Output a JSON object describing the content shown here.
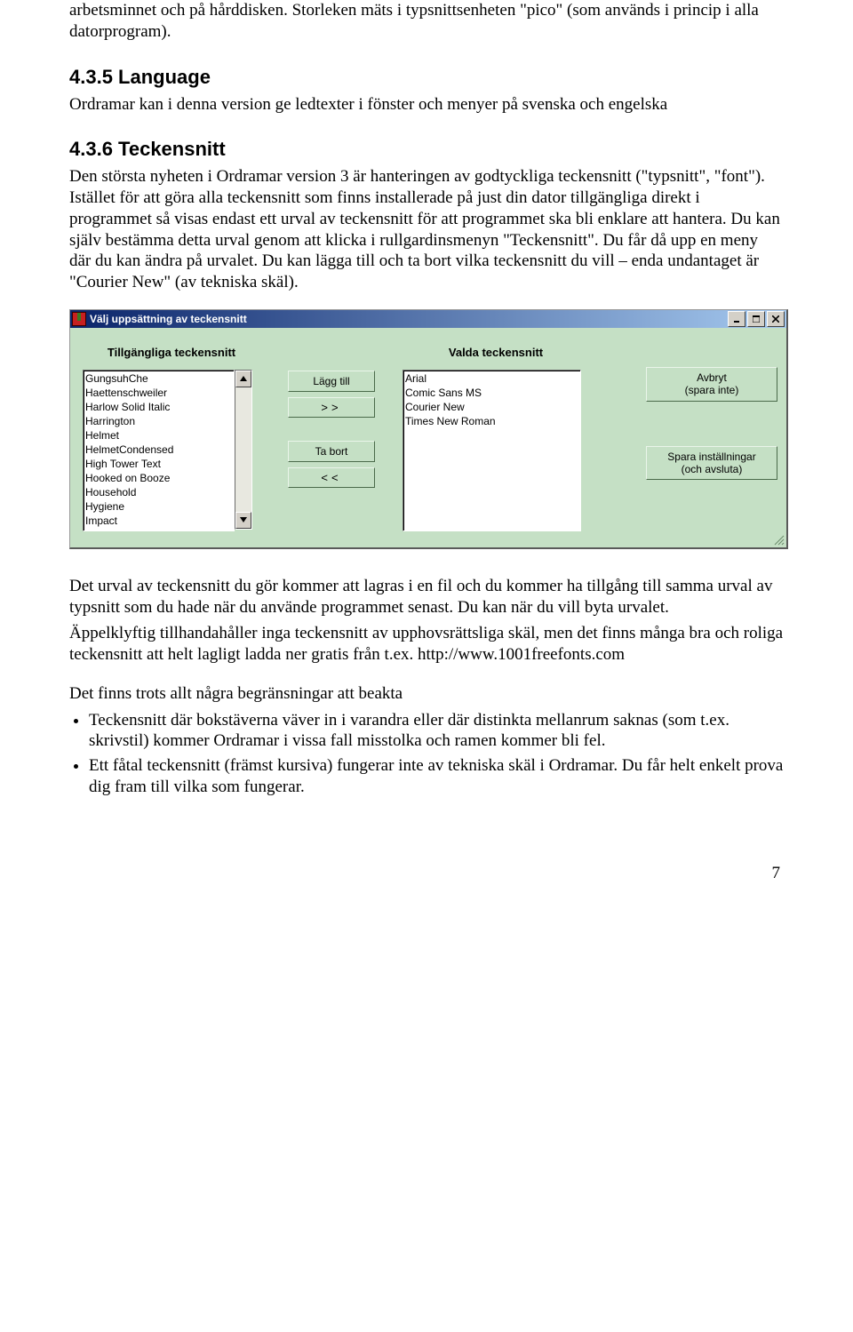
{
  "para_intro": "arbetsminnet och på hårddisken. Storleken mäts i typsnittsenheten \"pico\" (som används i princip i alla datorprogram).",
  "h_lang": "4.3.5 Language",
  "para_lang": "Ordramar kan i denna version ge ledtexter i fönster och menyer på svenska och engelska",
  "h_teck": "4.3.6 Teckensnitt",
  "para_teck": "Den största nyheten i Ordramar version 3 är hanteringen av godtyckliga teckensnitt (\"typsnitt\", \"font\"). Istället för att göra alla teckensnitt som finns installerade på just din dator tillgängliga direkt i programmet så visas endast ett urval av teckensnitt för att programmet ska bli enklare att hantera. Du kan själv bestämma detta urval genom att klicka i rullgardinsmenyn \"Teckensnitt\". Du får då upp en meny där du kan ändra på urvalet. Du kan lägga till och ta bort vilka teckensnitt du vill – enda undantaget är \"Courier New\" (av tekniska skäl).",
  "dialog": {
    "title": "Välj uppsättning av teckensnitt",
    "left_label": "Tillgängliga teckensnitt",
    "right_label": "Valda teckensnitt",
    "add_label": "Lägg till",
    "add_glyph": ">>",
    "remove_label": "Ta bort",
    "remove_glyph": "<<",
    "cancel_line1": "Avbryt",
    "cancel_line2": "(spara inte)",
    "save_line1": "Spara inställningar",
    "save_line2": "(och avsluta)",
    "available": [
      "GungsuhChe",
      "Haettenschweiler",
      "Harlow Solid Italic",
      "Harrington",
      "Helmet",
      "HelmetCondensed",
      "High Tower Text",
      "Hooked on Booze",
      "Household",
      "Hygiene",
      "Impact"
    ],
    "selected": [
      "Arial",
      "Comic Sans MS",
      "Courier New",
      "Times New Roman"
    ]
  },
  "para_after": "Det urval av teckensnitt du gör kommer att lagras i en fil och du kommer ha tillgång till samma urval av typsnitt som du hade när du använde programmet senast. Du kan när du vill byta urvalet.",
  "para_appel": "Äppelklyftig tillhandahåller inga teckensnitt av upphovsrättsliga skäl, men det finns många bra och roliga teckensnitt att helt lagligt ladda ner gratis från t.ex. http://www.1001freefonts.com",
  "para_limits": "Det finns trots allt några begränsningar att beakta",
  "bullet1": "Teckensnitt där bokstäverna väver in i varandra eller där distinkta mellanrum saknas (som t.ex. skrivstil) kommer Ordramar i vissa fall misstolka och ramen kommer bli fel.",
  "bullet2": "Ett fåtal teckensnitt (främst kursiva) fungerar inte av tekniska skäl i Ordramar. Du får helt enkelt prova dig fram till vilka som fungerar.",
  "page_number": "7"
}
